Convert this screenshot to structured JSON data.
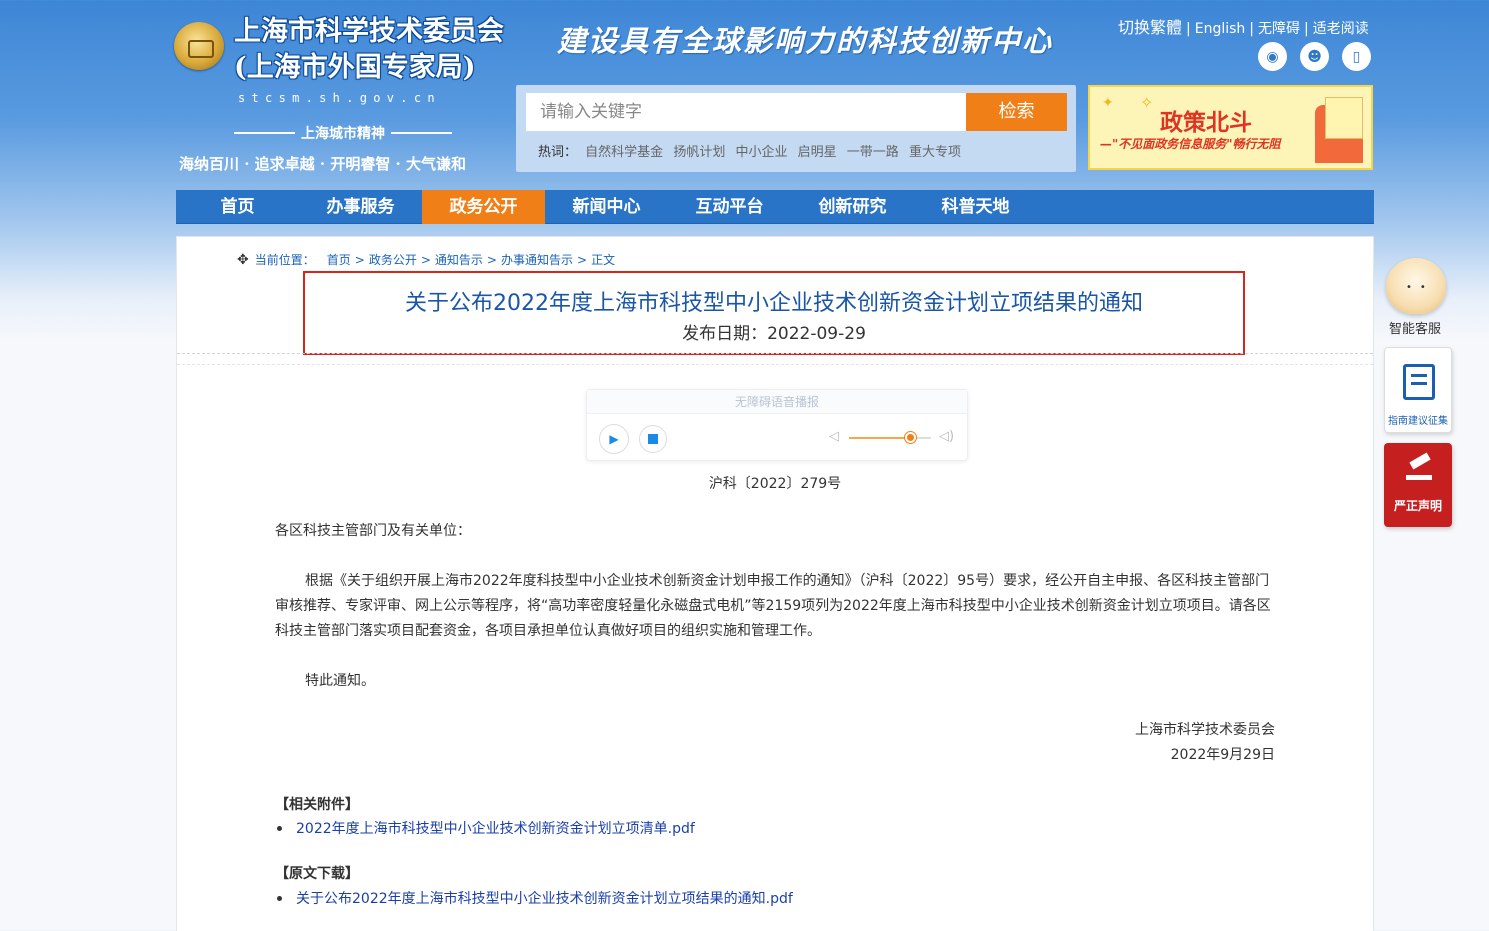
{
  "header": {
    "title_line1": "上海市科学技术委员会",
    "title_line2": "(上海市外国专家局)",
    "domain": "stcsm.sh.gov.cn",
    "spirit_heading": "上海城市精神",
    "spirit_text": "海纳百川 · 追求卓越 · 开明睿智 · 大气谦和",
    "slogan": "建设具有全球影响力的科技创新中心",
    "top_links": {
      "traditional": "切换繁體",
      "english": "English",
      "accessibility": "无障碍",
      "elderly": "适老阅读"
    },
    "social_icons": [
      "weibo-icon",
      "wechat-icon",
      "mobile-icon"
    ]
  },
  "search": {
    "placeholder": "请输入关键字",
    "button": "检索",
    "hot_label": "热词：",
    "hot_words": [
      "自然科学基金",
      "扬帆计划",
      "中小企业",
      "启明星",
      "一带一路",
      "重大专项"
    ]
  },
  "banner": {
    "title": "政策北斗",
    "subtitle": "—\"不见面政务信息服务\"畅行无阻"
  },
  "nav": {
    "items": [
      "首页",
      "办事服务",
      "政务公开",
      "新闻中心",
      "互动平台",
      "创新研究",
      "科普天地"
    ],
    "active_index": 2
  },
  "breadcrumb": {
    "label": "当前位置：",
    "items": [
      "首页",
      "政务公开",
      "通知告示",
      "办事通知告示",
      "正文"
    ]
  },
  "article": {
    "title": "关于公布2022年度上海市科技型中小企业技术创新资金计划立项结果的通知",
    "date": "发布日期：2022-09-29",
    "audio_label": "无障碍语音播报",
    "doc_number": "沪科〔2022〕279号",
    "greeting": "各区科技主管部门及有关单位：",
    "body": "根据《关于组织开展上海市2022年度科技型中小企业技术创新资金计划申报工作的通知》（沪科〔2022〕95号）要求，经公开自主申报、各区科技主管部门审核推荐、专家评审、网上公示等程序，将“高功率密度轻量化永磁盘式电机”等2159项列为2022年度上海市科技型中小企业技术创新资金计划立项项目。请各区科技主管部门落实项目配套资金，各项目承担单位认真做好项目的组织实施和管理工作。",
    "closing": "特此通知。",
    "sign_org": "上海市科学技术委员会",
    "sign_date": "2022年9月29日",
    "attachments_title": "【相关附件】",
    "attachment": "2022年度上海市科技型中小企业技术创新资金计划立项清单.pdf",
    "download_title": "【原文下载】",
    "download": "关于公布2022年度上海市科技型中小企业技术创新资金计划立项结果的通知.pdf"
  },
  "floaters": {
    "bot": "智能客服",
    "guide": "指南建议征集",
    "statement": "严正声明"
  }
}
